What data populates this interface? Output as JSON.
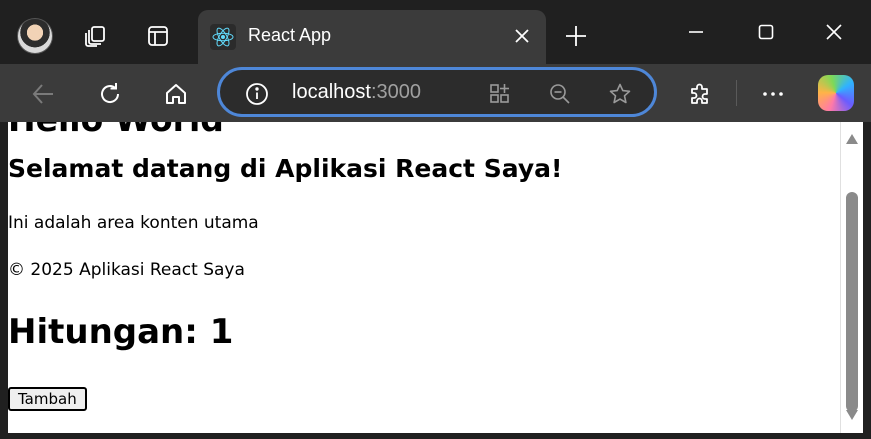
{
  "browser": {
    "tab": {
      "title": "React App",
      "favicon": "react-logo-icon"
    },
    "address": {
      "host": "localhost",
      "port": ":3000"
    },
    "icons": {
      "profile": "profile-avatar",
      "workspaces": "workspaces-icon",
      "tab_actions": "tab-actions-icon",
      "close_tab": "close-icon",
      "new_tab": "plus-icon",
      "minimize": "minimize-icon",
      "maximize": "maximize-icon",
      "close_window": "close-window-icon",
      "back": "back-arrow-icon",
      "refresh": "refresh-icon",
      "home": "home-icon",
      "site_info": "info-icon",
      "app_available": "app-available-icon",
      "zoom": "zoom-out-icon",
      "favorite": "star-icon",
      "extensions": "puzzle-icon",
      "menu": "more-icon",
      "copilot": "copilot-icon"
    },
    "colors": {
      "accent": "#4e87d8",
      "frame": "#202020",
      "toolbar": "#3b3b3b"
    }
  },
  "page": {
    "heading": "Hello World",
    "subheading": "Selamat datang di Aplikasi React Saya!",
    "main_text": "Ini adalah area konten utama",
    "footer_text": "© 2025 Aplikasi React Saya",
    "counter_heading": "Hitungan: 1",
    "add_button": "Tambah"
  }
}
